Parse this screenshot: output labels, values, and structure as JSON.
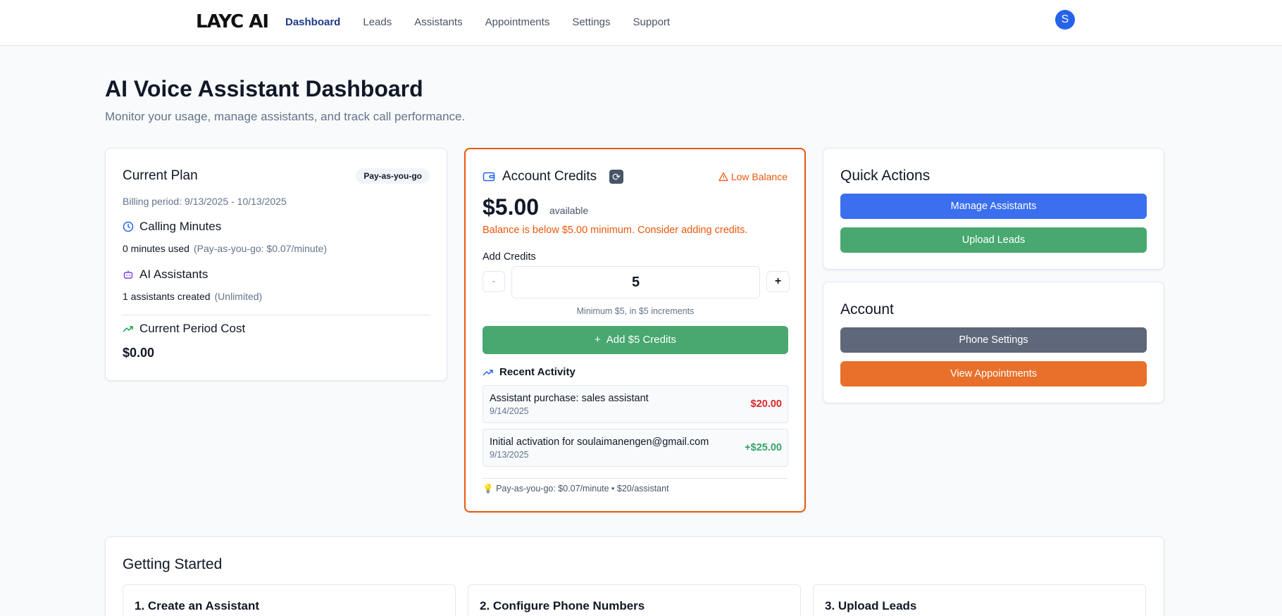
{
  "nav": {
    "logo": "LAYC AI",
    "items": [
      {
        "label": "Dashboard",
        "active": true
      },
      {
        "label": "Leads"
      },
      {
        "label": "Assistants"
      },
      {
        "label": "Appointments"
      },
      {
        "label": "Settings"
      },
      {
        "label": "Support"
      }
    ],
    "avatar": "S"
  },
  "header": {
    "title": "AI Voice Assistant Dashboard",
    "subtitle": "Monitor your usage, manage assistants, and track call performance."
  },
  "plan": {
    "title": "Current Plan",
    "badge": "Pay-as-you-go",
    "billing": "Billing period: 9/13/2025 - 10/13/2025",
    "minutes_title": "Calling Minutes",
    "minutes_used": "0 minutes used",
    "minutes_note": "(Pay-as-you-go: $0.07/minute)",
    "assistants_title": "AI Assistants",
    "assistants_created": "1 assistants created",
    "assistants_note": "(Unlimited)",
    "cost_title": "Current Period Cost",
    "cost_value": "$0.00"
  },
  "credits": {
    "title": "Account Credits",
    "low_label": "Low Balance",
    "balance": "$5.00",
    "available": "available",
    "warning": "Balance is below $5.00 minimum. Consider adding credits.",
    "add_label": "Add Credits",
    "minus": "-",
    "quantity": "5",
    "plus": "+",
    "min_note": "Minimum $5, in $5 increments",
    "add_button": "Add $5 Credits",
    "recent_title": "Recent Activity",
    "activity": [
      {
        "desc": "Assistant purchase: sales assistant",
        "date": "9/14/2025",
        "amount": "$20.00",
        "color": "#dc2626"
      },
      {
        "desc": "Initial activation for soulaimanengen@gmail.com",
        "date": "9/13/2025",
        "amount": "+$25.00",
        "color": "#38a169"
      }
    ],
    "footer": "Pay-as-you-go: $0.07/minute • $20/assistant"
  },
  "quick_actions": {
    "title": "Quick Actions",
    "manage": "Manage Assistants",
    "upload": "Upload Leads"
  },
  "account": {
    "title": "Account",
    "phone": "Phone Settings",
    "appointments": "View Appointments"
  },
  "getting_started": {
    "title": "Getting Started",
    "steps": [
      "1. Create an Assistant",
      "2. Configure Phone Numbers",
      "3. Upload Leads"
    ]
  },
  "colors": {
    "primary_blue": "#3b6ff0",
    "green": "#48a870",
    "slate": "#5f687a",
    "orange": "#e8702a"
  }
}
